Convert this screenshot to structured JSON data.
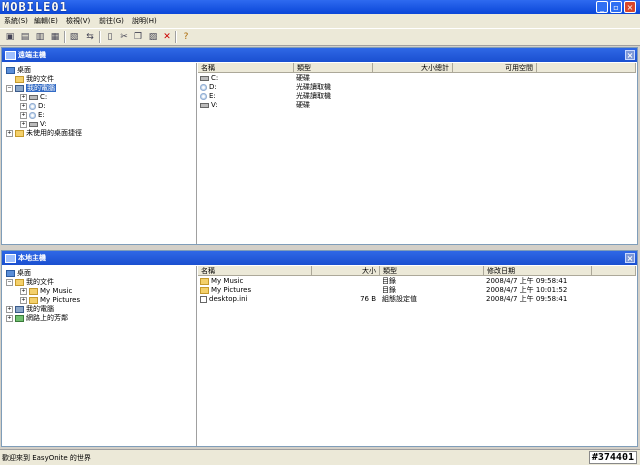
{
  "window": {
    "logo": "MOBILE01",
    "buttons": [
      "_",
      "▫",
      "×"
    ]
  },
  "menu": [
    "系統(S)",
    "編輯(E)",
    "檢視(V)",
    "前往(G)",
    "說明(H)"
  ],
  "toolbar_icons": [
    "connect-icon",
    "disconnect-icon",
    "reconnect-icon",
    "stop-icon",
    "upload-icon",
    "sync-icon",
    "new-icon",
    "cut-icon",
    "copy-icon",
    "paste-icon",
    "delete-icon",
    "help-icon"
  ],
  "remote": {
    "title": "遠端主機",
    "tree": {
      "root": "桌面",
      "docs": "我的文件",
      "computer": "我的電腦",
      "drives": [
        "C:",
        "D:",
        "E:",
        "V:"
      ],
      "unused": "未使用的桌面捷徑"
    },
    "columns": [
      "名稱",
      "類型",
      "大小總計",
      "可用空間"
    ],
    "rows": [
      {
        "name": "C:",
        "type": "硬碟",
        "icon": "drive"
      },
      {
        "name": "D:",
        "type": "光碟讀取機",
        "icon": "cdrom"
      },
      {
        "name": "E:",
        "type": "光碟讀取機",
        "icon": "cdrom"
      },
      {
        "name": "V:",
        "type": "硬碟",
        "icon": "drive"
      }
    ]
  },
  "local": {
    "title": "本地主機",
    "tree": {
      "root": "桌面",
      "docs": "我的文件",
      "music": "My Music",
      "pictures": "My Pictures",
      "computer": "我的電腦",
      "network": "網路上的芳鄰"
    },
    "columns": [
      "名稱",
      "大小",
      "類型",
      "修改日期"
    ],
    "rows": [
      {
        "name": "My Music",
        "size": "",
        "type": "目錄",
        "date": "2008/4/7 上午 09:58:41",
        "icon": "folder"
      },
      {
        "name": "My Pictures",
        "size": "",
        "type": "目錄",
        "date": "2008/4/7 上午 10:01:52",
        "icon": "folder"
      },
      {
        "name": "desktop.ini",
        "size": "76 B",
        "type": "組態設定值",
        "date": "2008/4/7 上午 09:58:41",
        "icon": "doc"
      }
    ]
  },
  "status": {
    "text": "歡迎來到 EasyOnite 的世界",
    "watermark": "#374401"
  }
}
